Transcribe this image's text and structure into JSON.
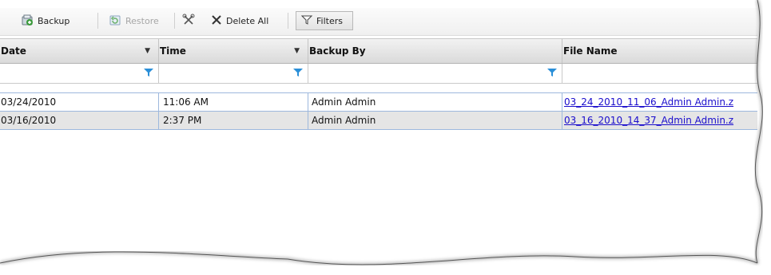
{
  "toolbar": {
    "backup_label": "Backup",
    "restore_label": "Restore",
    "delete_all_label": "Delete All",
    "filters_label": "Filters"
  },
  "grid": {
    "columns": [
      "Date",
      "Time",
      "Backup By",
      "File Name"
    ],
    "rows": [
      {
        "date": "03/24/2010",
        "time": "11:06 AM",
        "backup_by": "Admin Admin",
        "file_name": "03_24_2010_11_06_Admin Admin.z"
      },
      {
        "date": "03/16/2010",
        "time": "2:37 PM",
        "backup_by": "Admin Admin",
        "file_name": "03_16_2010_14_37_Admin Admin.z"
      }
    ]
  },
  "colors": {
    "row_border": "#9db8dd",
    "alt_row": "#e5e5e5",
    "link": "#1a0dcc",
    "filter_icon": "#2a8fd8",
    "backup_icon": "#3a9a3a"
  },
  "icons": [
    "backup-icon",
    "restore-icon",
    "scissors-icon",
    "delete-icon",
    "filter-icon"
  ]
}
